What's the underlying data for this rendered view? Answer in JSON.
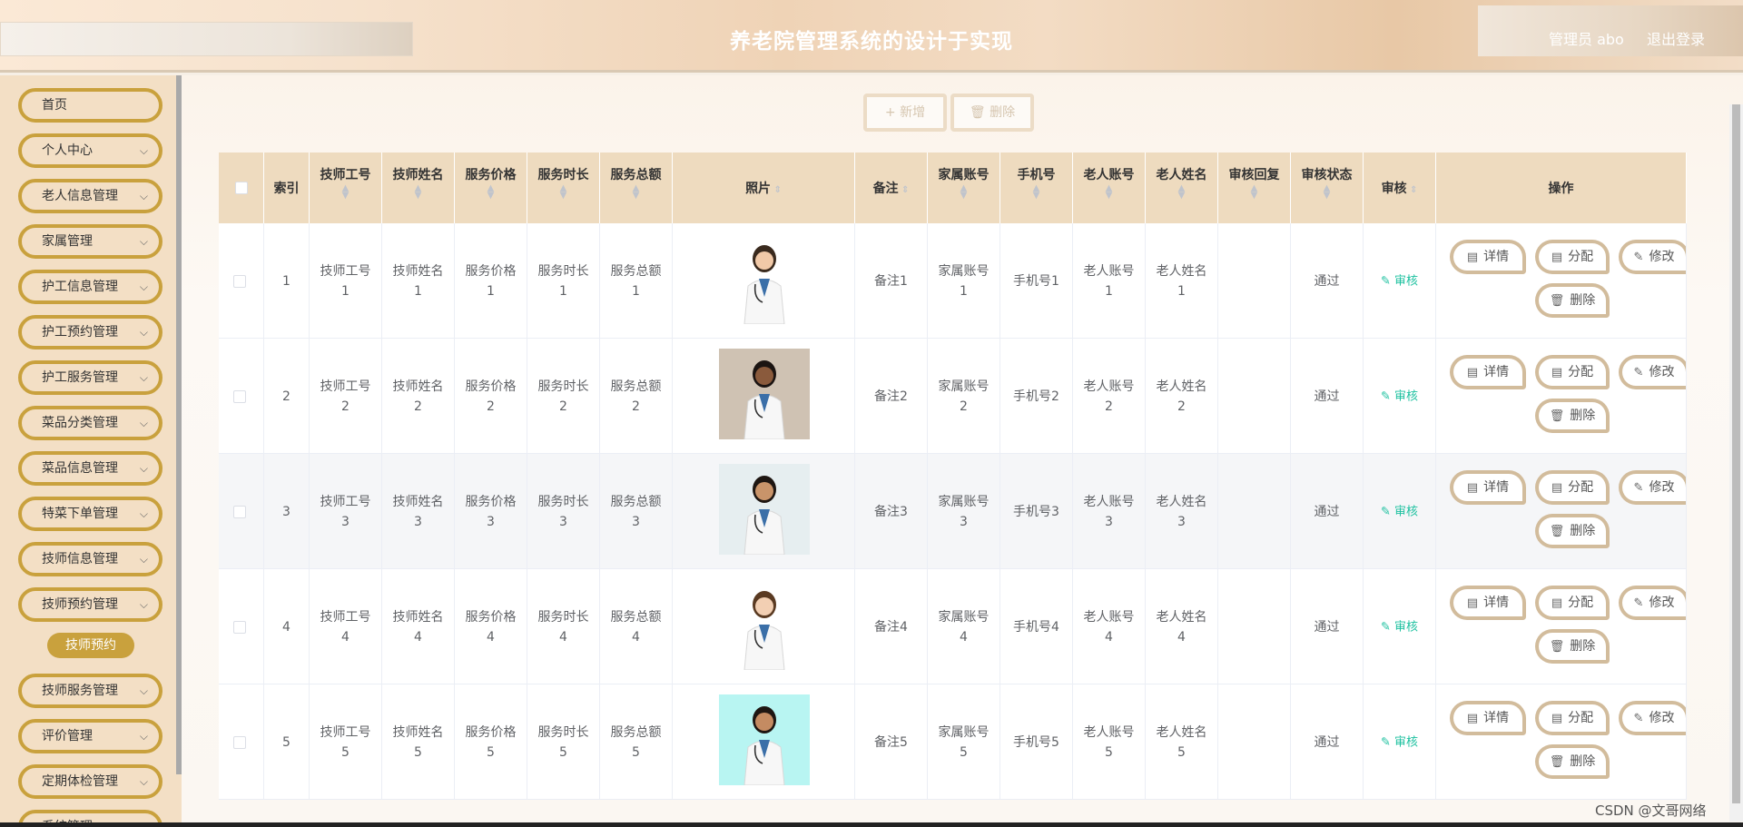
{
  "header": {
    "title": "养老院管理系统的设计于实现",
    "user": "管理员 abo",
    "logout": "退出登录"
  },
  "sidebar": {
    "items": [
      {
        "label": "首页",
        "chevron": false
      },
      {
        "label": "个人中心",
        "chevron": true
      },
      {
        "label": "老人信息管理",
        "chevron": true
      },
      {
        "label": "家属管理",
        "chevron": true
      },
      {
        "label": "护工信息管理",
        "chevron": true
      },
      {
        "label": "护工预约管理",
        "chevron": true
      },
      {
        "label": "护工服务管理",
        "chevron": true
      },
      {
        "label": "菜品分类管理",
        "chevron": true
      },
      {
        "label": "菜品信息管理",
        "chevron": true
      },
      {
        "label": "特菜下单管理",
        "chevron": true
      },
      {
        "label": "技师信息管理",
        "chevron": true
      },
      {
        "label": "技师预约管理",
        "chevron": true
      },
      {
        "label": "技师服务管理",
        "chevron": true
      },
      {
        "label": "评价管理",
        "chevron": true
      },
      {
        "label": "定期体检管理",
        "chevron": true
      },
      {
        "label": "系统管理",
        "chevron": true
      }
    ],
    "active_sub": "技师预约"
  },
  "toolbar": {
    "add": "+ 新增",
    "delete": "删除"
  },
  "table": {
    "headers": {
      "index": "索引",
      "tech_no": "技师工号",
      "tech_name": "技师姓名",
      "price": "服务价格",
      "duration": "服务时长",
      "total": "服务总额",
      "photo": "照片",
      "remark": "备注",
      "family_acct": "家属账号",
      "phone": "手机号",
      "elder_acct": "老人账号",
      "elder_name": "老人姓名",
      "reply": "审核回复",
      "status": "审核状态",
      "audit": "审核",
      "ops": "操作"
    },
    "rows": [
      {
        "index": "1",
        "tech_no": "技师工号1",
        "tech_name": "技师姓名1",
        "price": "服务价格1",
        "duration": "服务时长1",
        "total": "服务总额1",
        "remark": "备注1",
        "family_acct": "家属账号1",
        "phone": "手机号1",
        "elder_acct": "老人账号1",
        "elder_name": "老人姓名1",
        "reply": "",
        "status": "通过",
        "audit": "审核"
      },
      {
        "index": "2",
        "tech_no": "技师工号2",
        "tech_name": "技师姓名2",
        "price": "服务价格2",
        "duration": "服务时长2",
        "total": "服务总额2",
        "remark": "备注2",
        "family_acct": "家属账号2",
        "phone": "手机号2",
        "elder_acct": "老人账号2",
        "elder_name": "老人姓名2",
        "reply": "",
        "status": "通过",
        "audit": "审核"
      },
      {
        "index": "3",
        "tech_no": "技师工号3",
        "tech_name": "技师姓名3",
        "price": "服务价格3",
        "duration": "服务时长3",
        "total": "服务总额3",
        "remark": "备注3",
        "family_acct": "家属账号3",
        "phone": "手机号3",
        "elder_acct": "老人账号3",
        "elder_name": "老人姓名3",
        "reply": "",
        "status": "通过",
        "audit": "审核"
      },
      {
        "index": "4",
        "tech_no": "技师工号4",
        "tech_name": "技师姓名4",
        "price": "服务价格4",
        "duration": "服务时长4",
        "total": "服务总额4",
        "remark": "备注4",
        "family_acct": "家属账号4",
        "phone": "手机号4",
        "elder_acct": "老人账号4",
        "elder_name": "老人姓名4",
        "reply": "",
        "status": "通过",
        "audit": "审核"
      },
      {
        "index": "5",
        "tech_no": "技师工号5",
        "tech_name": "技师姓名5",
        "price": "服务价格5",
        "duration": "服务时长5",
        "total": "服务总额5",
        "remark": "备注5",
        "family_acct": "家属账号5",
        "phone": "手机号5",
        "elder_acct": "老人账号5",
        "elder_name": "老人姓名5",
        "reply": "",
        "status": "通过",
        "audit": "审核"
      }
    ],
    "row_buttons": {
      "detail": "详情",
      "assign": "分配",
      "edit": "修改",
      "delete": "删除"
    }
  },
  "watermark": "CSDN @文哥网络"
}
